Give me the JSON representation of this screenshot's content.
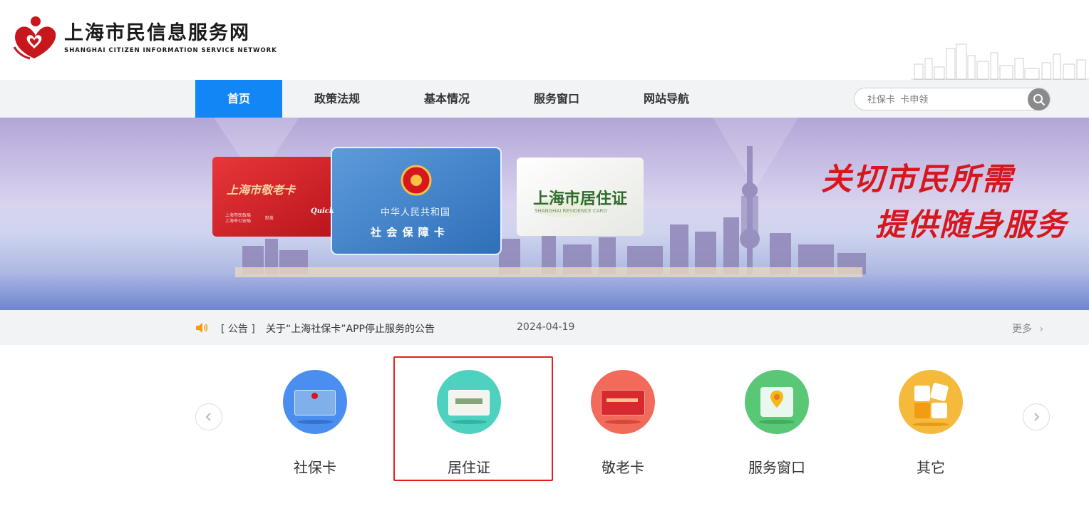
{
  "site": {
    "title_cn": "上海市民信息服务网",
    "title_en": "SHANGHAI CITIZEN INFORMATION SERVICE NETWORK",
    "brand_color": "#1186f4",
    "logo_icon": "heart-people-logo-icon"
  },
  "nav": {
    "items": [
      {
        "label": "首页",
        "active": true
      },
      {
        "label": "政策法规",
        "active": false
      },
      {
        "label": "基本情况",
        "active": false
      },
      {
        "label": "服务窗口",
        "active": false
      },
      {
        "label": "网站导航",
        "active": false
      }
    ]
  },
  "search": {
    "placeholder": "社保卡  卡申领",
    "icon": "search-icon"
  },
  "banner": {
    "slogan_line1": "关切市民所需",
    "slogan_line2": "提供随身服务",
    "cards": {
      "elderly": {
        "title": "上海市敬老卡",
        "org1": "上海市民政局",
        "org2": "上海市公安局",
        "tag": "制发",
        "brand": "Quick"
      },
      "social": {
        "line1": "中华人民共和国",
        "line2": "社 会 保 障 卡"
      },
      "residence": {
        "title": "上海市居住证",
        "subtitle": "SHANGHAI RESIDENCE CARD"
      }
    },
    "slogan_color": "#d7171e"
  },
  "notice": {
    "icon": "speaker-icon",
    "tag": "[ 公告 ]",
    "title": "关于“上海社保卡”APP停止服务的公告",
    "date": "2024-04-19",
    "more": "更多"
  },
  "services": {
    "items": [
      {
        "label": "社保卡",
        "icon": "social-security-card-icon",
        "color": "#4a8ff0"
      },
      {
        "label": "居住证",
        "icon": "residence-card-icon",
        "color": "#4fd1c0"
      },
      {
        "label": "敬老卡",
        "icon": "elderly-card-icon",
        "color": "#f26a5a"
      },
      {
        "label": "服务窗口",
        "icon": "map-pin-icon",
        "color": "#59c776"
      },
      {
        "label": "其它",
        "icon": "blocks-icon",
        "color": "#f5b93b"
      }
    ],
    "highlighted": "居住证"
  }
}
